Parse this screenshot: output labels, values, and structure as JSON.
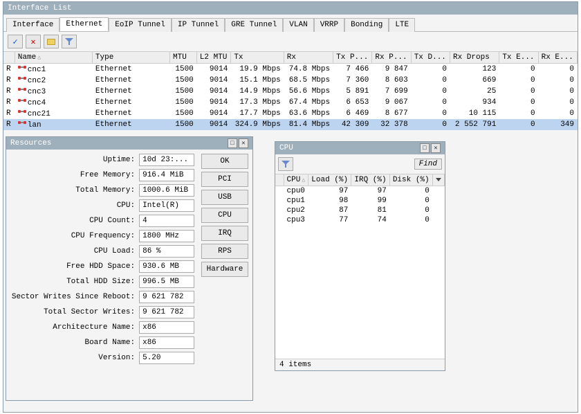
{
  "interface_list": {
    "title": "Interface List",
    "tabs": [
      "Interface",
      "Ethernet",
      "EoIP Tunnel",
      "IP Tunnel",
      "GRE Tunnel",
      "VLAN",
      "VRRP",
      "Bonding",
      "LTE"
    ],
    "active_tab": 1,
    "columns": [
      "",
      "Name",
      "Type",
      "MTU",
      "L2 MTU",
      "Tx",
      "Rx",
      "Tx P...",
      "Rx P...",
      "Tx D...",
      "Rx Drops",
      "Tx E...",
      "Rx E..."
    ],
    "rows": [
      {
        "flag": "R",
        "name": "cnc1",
        "type": "Ethernet",
        "mtu": "1500",
        "l2mtu": "9014",
        "tx": "19.9 Mbps",
        "rx": "74.8 Mbps",
        "txp": "7 466",
        "rxp": "9 847",
        "txd": "0",
        "rxd": "123",
        "txe": "0",
        "rxe": "0",
        "sel": false
      },
      {
        "flag": "R",
        "name": "cnc2",
        "type": "Ethernet",
        "mtu": "1500",
        "l2mtu": "9014",
        "tx": "15.1 Mbps",
        "rx": "68.5 Mbps",
        "txp": "7 360",
        "rxp": "8 603",
        "txd": "0",
        "rxd": "669",
        "txe": "0",
        "rxe": "0",
        "sel": false
      },
      {
        "flag": "R",
        "name": "cnc3",
        "type": "Ethernet",
        "mtu": "1500",
        "l2mtu": "9014",
        "tx": "14.9 Mbps",
        "rx": "56.6 Mbps",
        "txp": "5 891",
        "rxp": "7 699",
        "txd": "0",
        "rxd": "25",
        "txe": "0",
        "rxe": "0",
        "sel": false
      },
      {
        "flag": "R",
        "name": "cnc4",
        "type": "Ethernet",
        "mtu": "1500",
        "l2mtu": "9014",
        "tx": "17.3 Mbps",
        "rx": "67.4 Mbps",
        "txp": "6 653",
        "rxp": "9 067",
        "txd": "0",
        "rxd": "934",
        "txe": "0",
        "rxe": "0",
        "sel": false
      },
      {
        "flag": "R",
        "name": "cnc21",
        "type": "Ethernet",
        "mtu": "1500",
        "l2mtu": "9014",
        "tx": "17.7 Mbps",
        "rx": "63.6 Mbps",
        "txp": "6 469",
        "rxp": "8 677",
        "txd": "0",
        "rxd": "10 115",
        "txe": "0",
        "rxe": "0",
        "sel": false
      },
      {
        "flag": "R",
        "name": "lan",
        "type": "Ethernet",
        "mtu": "1500",
        "l2mtu": "9014",
        "tx": "324.9 Mbps",
        "rx": "81.4 Mbps",
        "txp": "42 309",
        "rxp": "32 378",
        "txd": "0",
        "rxd": "2 552 791",
        "txe": "0",
        "rxe": "349",
        "sel": true
      }
    ]
  },
  "resources": {
    "title": "Resources",
    "fields": {
      "uptime_label": "Uptime:",
      "uptime": "10d 23:...",
      "free_mem_label": "Free Memory:",
      "free_mem": "916.4 MiB",
      "total_mem_label": "Total Memory:",
      "total_mem": "1000.6 MiB",
      "cpu_label": "CPU:",
      "cpu": "Intel(R)",
      "cpu_count_label": "CPU Count:",
      "cpu_count": "4",
      "cpu_freq_label": "CPU Frequency:",
      "cpu_freq": "1800 MHz",
      "cpu_load_label": "CPU Load:",
      "cpu_load": "86 %",
      "free_hdd_label": "Free HDD Space:",
      "free_hdd": "930.6 MB",
      "total_hdd_label": "Total HDD Size:",
      "total_hdd": "996.5 MB",
      "sec_writes_reboot_label": "Sector Writes Since Reboot:",
      "sec_writes_reboot": "9 621 782",
      "total_sec_writes_label": "Total Sector Writes:",
      "total_sec_writes": "9 621 782",
      "arch_label": "Architecture Name:",
      "arch": "x86",
      "board_label": "Board Name:",
      "board": "x86",
      "version_label": "Version:",
      "version": "5.20"
    },
    "buttons": [
      "OK",
      "PCI",
      "USB",
      "CPU",
      "IRQ",
      "RPS",
      "Hardware"
    ]
  },
  "cpu": {
    "title": "CPU",
    "find": "Find",
    "columns": [
      "",
      "CPU",
      "Load (%)",
      "IRQ (%)",
      "Disk (%)"
    ],
    "rows": [
      {
        "name": "cpu0",
        "load": "97",
        "irq": "97",
        "disk": "0"
      },
      {
        "name": "cpu1",
        "load": "98",
        "irq": "99",
        "disk": "0"
      },
      {
        "name": "cpu2",
        "load": "87",
        "irq": "81",
        "disk": "0"
      },
      {
        "name": "cpu3",
        "load": "77",
        "irq": "74",
        "disk": "0"
      }
    ],
    "footer": "4 items"
  }
}
